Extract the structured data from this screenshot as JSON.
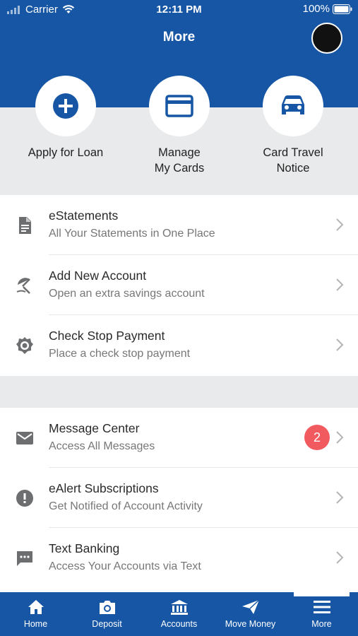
{
  "status_bar": {
    "carrier": "Carrier",
    "time": "12:11 PM",
    "battery": "100%"
  },
  "header": {
    "title": "More"
  },
  "quick_actions": [
    {
      "label_line1": "Apply for Loan",
      "label_line2": "",
      "icon": "plus-circle-icon"
    },
    {
      "label_line1": "Manage",
      "label_line2": "My Cards",
      "icon": "credit-card-icon"
    },
    {
      "label_line1": "Card Travel",
      "label_line2": "Notice",
      "icon": "car-icon"
    }
  ],
  "menu_group_1": [
    {
      "title": "eStatements",
      "subtitle": "All Your Statements in One Place",
      "icon": "document-icon"
    },
    {
      "title": "Add New Account",
      "subtitle": "Open an extra savings account",
      "icon": "beach-umbrella-icon"
    },
    {
      "title": "Check Stop Payment",
      "subtitle": "Place a check stop payment",
      "icon": "gear-icon"
    }
  ],
  "menu_group_2": [
    {
      "title": "Message Center",
      "subtitle": "Access All Messages",
      "icon": "envelope-icon",
      "badge": "2"
    },
    {
      "title": "eAlert Subscriptions",
      "subtitle": "Get Notified of Account Activity",
      "icon": "alert-icon"
    },
    {
      "title": "Text Banking",
      "subtitle": "Access Your Accounts via Text",
      "icon": "chat-icon"
    }
  ],
  "tabbar": [
    {
      "label": "Home",
      "icon": "home-icon"
    },
    {
      "label": "Deposit",
      "icon": "camera-icon"
    },
    {
      "label": "Accounts",
      "icon": "bank-icon"
    },
    {
      "label": "Move Money",
      "icon": "send-icon"
    },
    {
      "label": "More",
      "icon": "menu-icon"
    }
  ],
  "colors": {
    "brand_blue": "#1656a5",
    "badge_red": "#f15a5f",
    "icon_gray": "#6d6e70",
    "background_gray": "#e9eaeb"
  }
}
